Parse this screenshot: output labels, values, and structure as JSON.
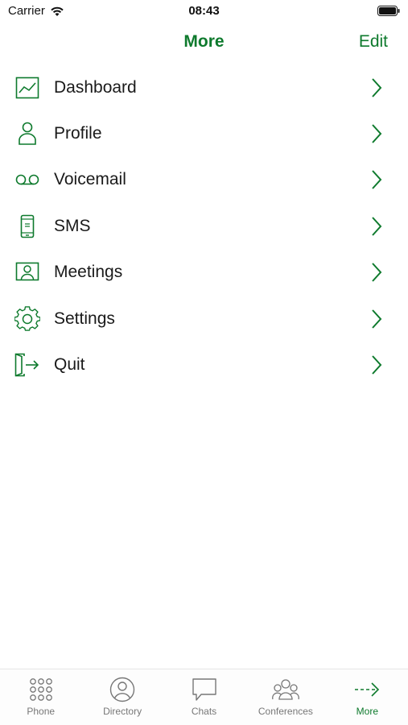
{
  "status_bar": {
    "carrier": "Carrier",
    "time": "08:43"
  },
  "nav": {
    "title": "More",
    "edit_label": "Edit"
  },
  "menu": {
    "items": [
      {
        "label": "Dashboard",
        "icon": "chart-icon"
      },
      {
        "label": "Profile",
        "icon": "person-icon"
      },
      {
        "label": "Voicemail",
        "icon": "voicemail-icon"
      },
      {
        "label": "SMS",
        "icon": "phone-device-icon"
      },
      {
        "label": "Meetings",
        "icon": "meeting-icon"
      },
      {
        "label": "Settings",
        "icon": "gear-icon"
      },
      {
        "label": "Quit",
        "icon": "exit-icon"
      }
    ]
  },
  "tabs": [
    {
      "label": "Phone",
      "icon": "keypad-icon",
      "active": false
    },
    {
      "label": "Directory",
      "icon": "contact-icon",
      "active": false
    },
    {
      "label": "Chats",
      "icon": "chat-bubble-icon",
      "active": false
    },
    {
      "label": "Conferences",
      "icon": "group-icon",
      "active": false
    },
    {
      "label": "More",
      "icon": "arrow-right-icon",
      "active": true
    }
  ],
  "colors": {
    "accent": "#0e7a2d",
    "text": "#1a1a1a",
    "tab_inactive": "#777777"
  }
}
